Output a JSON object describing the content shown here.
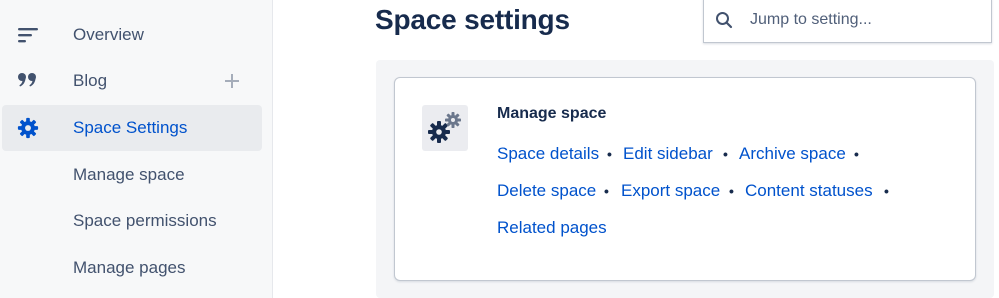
{
  "sidebar": {
    "items": [
      {
        "label": "Overview",
        "icon": "overview-lines-icon"
      },
      {
        "label": "Blog",
        "icon": "quote-icon",
        "action_icon": "plus-icon"
      },
      {
        "label": "Space Settings",
        "icon": "gear-icon",
        "active": true
      }
    ],
    "subitems": [
      {
        "label": "Manage space"
      },
      {
        "label": "Space permissions"
      },
      {
        "label": "Manage pages"
      }
    ]
  },
  "header": {
    "title": "Space settings"
  },
  "search": {
    "placeholder": "Jump to setting...",
    "icon": "search-icon"
  },
  "card": {
    "icon": "gears-icon",
    "title": "Manage space",
    "links": [
      {
        "label": "Space details"
      },
      {
        "label": "Edit sidebar"
      },
      {
        "label": "Archive space"
      },
      {
        "label": "Delete space"
      },
      {
        "label": "Export space"
      },
      {
        "label": "Content statuses"
      },
      {
        "label": "Related pages"
      }
    ],
    "separator": "•"
  },
  "colors": {
    "accent": "#0052cc",
    "text": "#172b4d",
    "muted": "#42526e",
    "sidebar_bg": "#f7f8f9",
    "active_bg": "#e9ebee",
    "panel_bg": "#f4f5f7"
  }
}
